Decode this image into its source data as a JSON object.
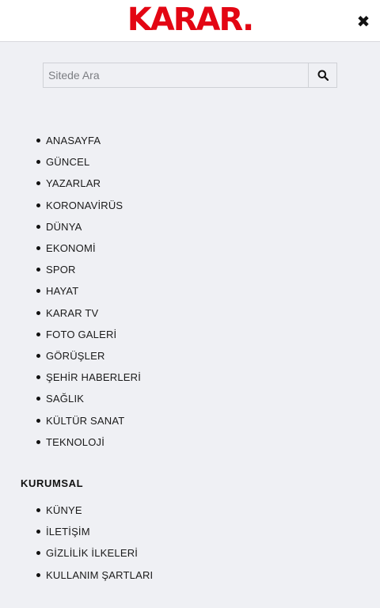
{
  "header": {
    "logo_text": "KARAR.",
    "close_icon": "close-icon"
  },
  "search": {
    "placeholder": "Sitede Ara",
    "icon": "search-icon"
  },
  "menu": {
    "items": [
      {
        "label": "ANASAYFA"
      },
      {
        "label": "GÜNCEL"
      },
      {
        "label": "YAZARLAR"
      },
      {
        "label": "KORONAVİRÜS"
      },
      {
        "label": "DÜNYA"
      },
      {
        "label": "EKONOMİ"
      },
      {
        "label": "SPOR"
      },
      {
        "label": "HAYAT"
      },
      {
        "label": "KARAR TV"
      },
      {
        "label": "FOTO GALERİ"
      },
      {
        "label": "GÖRÜŞLER"
      },
      {
        "label": "ŞEHİR HABERLERİ"
      },
      {
        "label": "SAĞLIK"
      },
      {
        "label": "KÜLTÜR SANAT"
      },
      {
        "label": "TEKNOLOJİ"
      }
    ]
  },
  "corporate": {
    "title": "KURUMSAL",
    "items": [
      {
        "label": "KÜNYE"
      },
      {
        "label": "İLETİŞİM"
      },
      {
        "label": "GİZLİLİK İLKELERİ"
      },
      {
        "label": "KULLANIM ŞARTLARI"
      }
    ]
  },
  "colors": {
    "brand": "#e30613",
    "background": "#eff0f4"
  }
}
